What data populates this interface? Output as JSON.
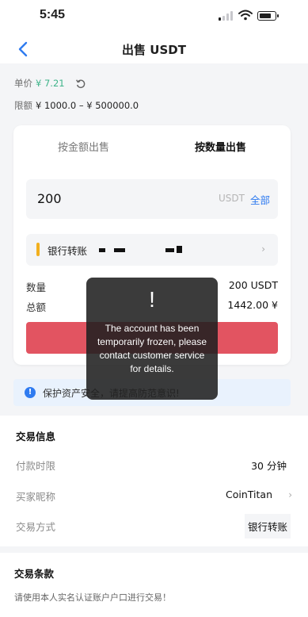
{
  "status_bar": {
    "time": "5:45"
  },
  "nav": {
    "title": "出售 USDT"
  },
  "info": {
    "price_label": "单价",
    "price_value": "¥ 7.21",
    "limit_label": "限额",
    "limit_value": "¥ 1000.0 – ¥ 500000.0"
  },
  "tabs": {
    "by_amount": "按金额出售",
    "by_quantity": "按数量出售"
  },
  "amount": {
    "value": "200",
    "unit": "USDT",
    "all_label": "全部"
  },
  "payment": {
    "method": "银行转账"
  },
  "summary": {
    "quantity_label": "数量",
    "quantity_value": "200 USDT",
    "total_label": "总额",
    "total_value": "1442.00 ¥"
  },
  "notice": {
    "text": "保护资产安全，请提高防范意识!"
  },
  "trade_info": {
    "title": "交易信息",
    "payment_time_label": "付款时限",
    "payment_time_value": "30 分钟",
    "buyer_label": "买家昵称",
    "buyer_value": "CoinTitan",
    "method_label": "交易方式",
    "method_value": "银行转账"
  },
  "terms": {
    "title": "交易条款",
    "text": "请使用本人实名认证账户户口进行交易！"
  },
  "toast": {
    "mark": "!",
    "message": "The account has been temporarily frozen, please contact customer service for details."
  },
  "colors": {
    "accent_blue": "#2f7bf0",
    "price_green": "#3fb48a",
    "sell_red": "#e25461",
    "payment_yellow": "#f2b01e"
  },
  "icons": [
    "back-arrow-icon",
    "refresh-icon",
    "info-icon",
    "chevron-right-icon",
    "signal-icon",
    "wifi-icon",
    "battery-icon"
  ]
}
